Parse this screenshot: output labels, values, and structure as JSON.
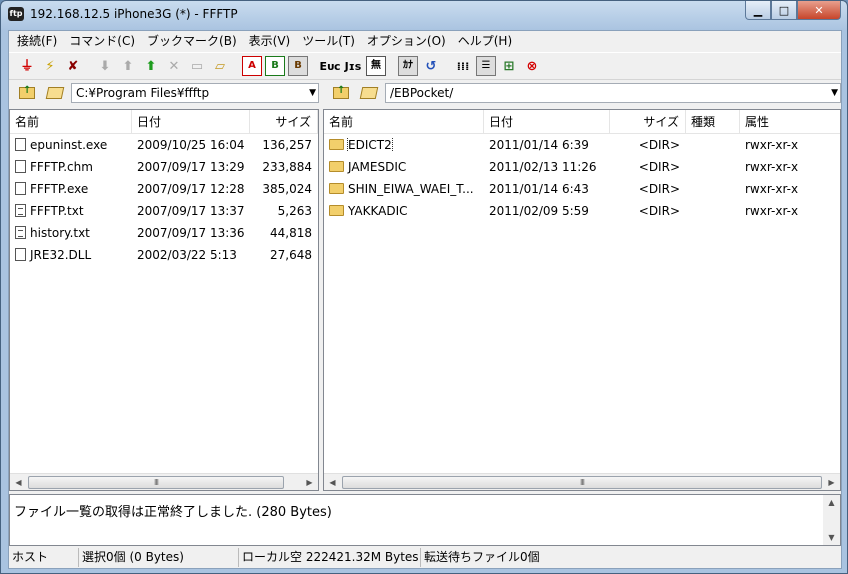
{
  "window": {
    "title": "192.168.12.5 iPhone3G (*) - FFFTP",
    "app_icon": "ftp"
  },
  "menu": [
    "接続(F)",
    "コマンド(C)",
    "ブックマーク(B)",
    "表示(V)",
    "ツール(T)",
    "オプション(O)",
    "ヘルプ(H)"
  ],
  "toolbar": {
    "labels": {
      "ascii": "A",
      "binary": "B",
      "auto": "B",
      "euc": "Eᴜᴄ",
      "jis": "Jɪs",
      "no_convert": "無",
      "kana": "ｶﾅ"
    },
    "icons": [
      "connect-icon",
      "quick-connect-icon",
      "disconnect-icon",
      "download-icon",
      "upload-icon",
      "mirror-upload-icon",
      "delete-icon",
      "rename-icon",
      "new-folder-icon",
      "ascii-mode-icon",
      "binary-mode-icon",
      "auto-mode-icon",
      "euc-icon",
      "jis-icon",
      "no-convert-icon",
      "kana-convert-icon",
      "refresh-icon",
      "list-view-icon",
      "detail-view-icon",
      "sync-tree-icon",
      "stop-icon"
    ]
  },
  "local": {
    "path": "C:¥Program Files¥ffftp",
    "columns": [
      "名前",
      "日付",
      "サイズ"
    ],
    "files": [
      {
        "name": "epuninst.exe",
        "date": "2009/10/25 16:04",
        "size": "136,257",
        "icon": "file-icon"
      },
      {
        "name": "FFFTP.chm",
        "date": "2007/09/17 13:29",
        "size": "233,884",
        "icon": "file-icon"
      },
      {
        "name": "FFFTP.exe",
        "date": "2007/09/17 12:28",
        "size": "385,024",
        "icon": "file-icon"
      },
      {
        "name": "FFFTP.txt",
        "date": "2007/09/17 13:37",
        "size": "5,263",
        "icon": "text-file-icon"
      },
      {
        "name": "history.txt",
        "date": "2007/09/17 13:36",
        "size": "44,818",
        "icon": "text-file-icon"
      },
      {
        "name": "JRE32.DLL",
        "date": "2002/03/22  5:13",
        "size": "27,648",
        "icon": "file-icon"
      }
    ],
    "scroll_grip": "III"
  },
  "remote": {
    "path": "/EBPocket/",
    "columns": [
      "名前",
      "日付",
      "サイズ",
      "種類",
      "属性"
    ],
    "files": [
      {
        "name": "EDICT2",
        "date": "2011/01/14  6:39",
        "size": "<DIR>",
        "type": "",
        "attr": "rwxr-xr-x"
      },
      {
        "name": "JAMESDIC",
        "date": "2011/02/13 11:26",
        "size": "<DIR>",
        "type": "",
        "attr": "rwxr-xr-x"
      },
      {
        "name": "SHIN_EIWA_WAEI_T...",
        "date": "2011/01/14  6:43",
        "size": "<DIR>",
        "type": "",
        "attr": "rwxr-xr-x"
      },
      {
        "name": "YAKKADIC",
        "date": "2011/02/09  5:59",
        "size": "<DIR>",
        "type": "",
        "attr": "rwxr-xr-x"
      }
    ],
    "scroll_grip": "III"
  },
  "log": {
    "text": "ファイル一覧の取得は正常終了しました. (280 Bytes)"
  },
  "status": {
    "host": "ホスト",
    "selection": "選択0個 (0 Bytes)",
    "local_free": "ローカル空 222421.32M Bytes",
    "queue": "転送待ちファイル0個"
  }
}
